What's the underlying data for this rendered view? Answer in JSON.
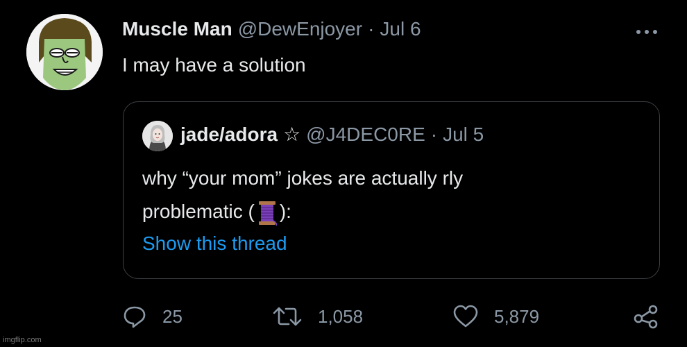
{
  "post": {
    "author_name": "Muscle Man",
    "author_handle": "@DewEnjoyer",
    "separator": "·",
    "date": "Jul 6",
    "text": "I may have a solution",
    "more_icon": "more-dots-icon"
  },
  "quoted": {
    "author_name": "jade/adora",
    "badge": "☆",
    "author_handle": "@J4DEC0RE",
    "separator": "·",
    "date": "Jul 5",
    "line1": "why “your mom” jokes are actually rly",
    "line2_before": "problematic (",
    "line2_icon": "thread-spool-icon",
    "line2_after": "):",
    "link_label": "Show this thread"
  },
  "actions": {
    "reply_count": "25",
    "retweet_count": "1,058",
    "like_count": "5,879",
    "reply_icon": "reply-icon",
    "retweet_icon": "retweet-icon",
    "like_icon": "heart-icon",
    "share_icon": "share-icon"
  },
  "watermark": "imgflip.com",
  "colors": {
    "background": "#000000",
    "text": "#e7e9ea",
    "secondary": "#8b98a5",
    "link": "#1d9bf0",
    "border": "#3c4044"
  }
}
